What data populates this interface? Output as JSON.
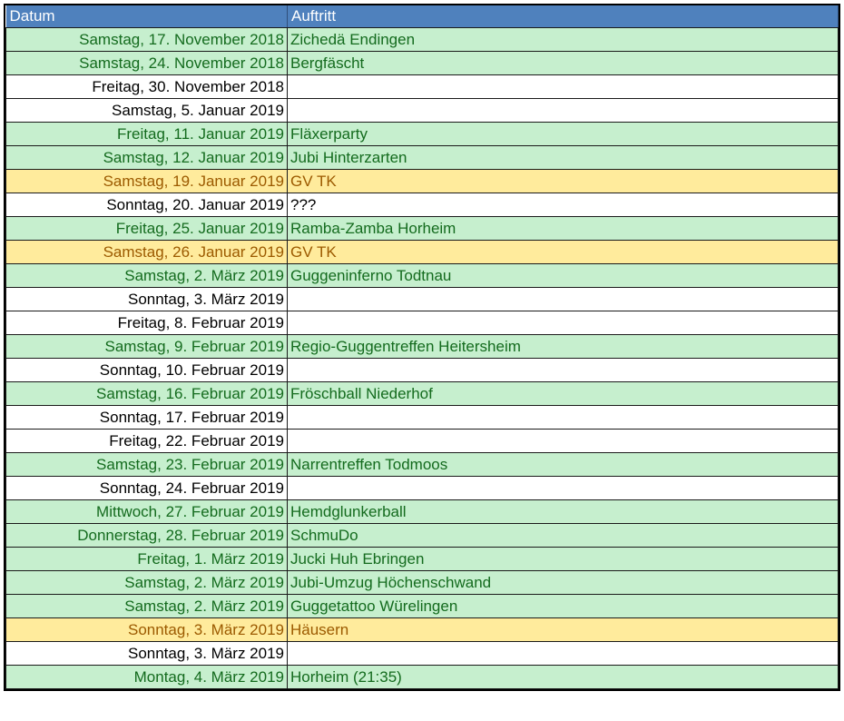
{
  "header": {
    "col_date": "Datum",
    "col_event": "Auftritt"
  },
  "colors": {
    "header_bg": "#4f81bd",
    "green_bg": "#c6efce",
    "green_fg": "#146b1e",
    "yellow_bg": "#ffeb9c",
    "yellow_fg": "#9c5a00"
  },
  "rows": [
    {
      "date": "Samstag, 17. November 2018",
      "event": "Zichedä Endingen",
      "style": "green"
    },
    {
      "date": "Samstag, 24. November 2018",
      "event": "Bergfäscht",
      "style": "green"
    },
    {
      "date": "Freitag, 30. November 2018",
      "event": "",
      "style": "white"
    },
    {
      "date": "Samstag, 5. Januar 2019",
      "event": "",
      "style": "white"
    },
    {
      "date": "Freitag, 11. Januar 2019",
      "event": "Fläxerparty",
      "style": "green"
    },
    {
      "date": "Samstag, 12. Januar 2019",
      "event": "Jubi Hinterzarten",
      "style": "green"
    },
    {
      "date": "Samstag, 19. Januar 2019",
      "event": "GV TK",
      "style": "yellow"
    },
    {
      "date": "Sonntag, 20. Januar 2019",
      "event": "???",
      "style": "white"
    },
    {
      "date": "Freitag, 25. Januar 2019",
      "event": "Ramba-Zamba Horheim",
      "style": "green"
    },
    {
      "date": "Samstag, 26. Januar 2019",
      "event": "GV TK",
      "style": "yellow"
    },
    {
      "date": "Samstag, 2. März 2019",
      "event": "Guggeninferno Todtnau",
      "style": "green"
    },
    {
      "date": "Sonntag, 3. März 2019",
      "event": "",
      "style": "white"
    },
    {
      "date": "Freitag, 8. Februar 2019",
      "event": "",
      "style": "white"
    },
    {
      "date": "Samstag, 9. Februar 2019",
      "event": "Regio-Guggentreffen Heitersheim",
      "style": "green"
    },
    {
      "date": "Sonntag, 10. Februar 2019",
      "event": "",
      "style": "white"
    },
    {
      "date": "Samstag, 16. Februar 2019",
      "event": "Fröschball Niederhof",
      "style": "green"
    },
    {
      "date": "Sonntag, 17. Februar 2019",
      "event": "",
      "style": "white"
    },
    {
      "date": "Freitag, 22. Februar 2019",
      "event": "",
      "style": "white"
    },
    {
      "date": "Samstag, 23. Februar 2019",
      "event": "Narrentreffen Todmoos",
      "style": "green"
    },
    {
      "date": "Sonntag, 24. Februar 2019",
      "event": "",
      "style": "white"
    },
    {
      "date": "Mittwoch, 27. Februar 2019",
      "event": "Hemdglunkerball",
      "style": "green"
    },
    {
      "date": "Donnerstag, 28. Februar 2019",
      "event": "SchmuDo",
      "style": "green"
    },
    {
      "date": "Freitag, 1. März 2019",
      "event": "Jucki Huh Ebringen",
      "style": "green"
    },
    {
      "date": "Samstag, 2. März 2019",
      "event": "Jubi-Umzug Höchenschwand",
      "style": "green"
    },
    {
      "date": "Samstag, 2. März 2019",
      "event": "Guggetattoo Würelingen",
      "style": "green"
    },
    {
      "date": "Sonntag, 3. März 2019",
      "event": "Häusern",
      "style": "yellow"
    },
    {
      "date": "Sonntag, 3. März 2019",
      "event": "",
      "style": "white"
    },
    {
      "date": "Montag, 4. März 2019",
      "event": " Horheim (21:35)",
      "style": "green"
    }
  ]
}
